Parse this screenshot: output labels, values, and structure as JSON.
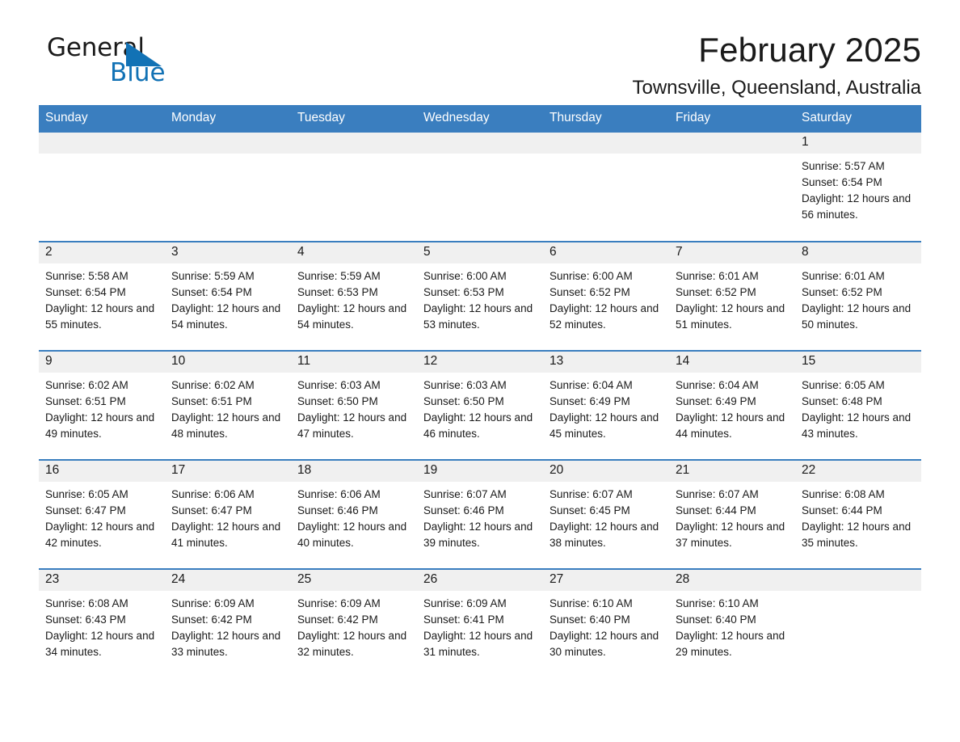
{
  "brand": {
    "name_dark": "General",
    "name_blue": "Blue",
    "accent_color": "#1272b5"
  },
  "header": {
    "title": "February 2025",
    "subtitle": "Townsville, Queensland, Australia"
  },
  "theme": {
    "header_blue": "#3a7ebf",
    "daynum_band": "#f0f0f0",
    "text": "#1a1a1a"
  },
  "calendar": {
    "weekday_headers": [
      "Sunday",
      "Monday",
      "Tuesday",
      "Wednesday",
      "Thursday",
      "Friday",
      "Saturday"
    ],
    "weeks": [
      [
        {
          "day": "",
          "sunrise": "",
          "sunset": "",
          "daylight": ""
        },
        {
          "day": "",
          "sunrise": "",
          "sunset": "",
          "daylight": ""
        },
        {
          "day": "",
          "sunrise": "",
          "sunset": "",
          "daylight": ""
        },
        {
          "day": "",
          "sunrise": "",
          "sunset": "",
          "daylight": ""
        },
        {
          "day": "",
          "sunrise": "",
          "sunset": "",
          "daylight": ""
        },
        {
          "day": "",
          "sunrise": "",
          "sunset": "",
          "daylight": ""
        },
        {
          "day": "1",
          "sunrise": "Sunrise: 5:57 AM",
          "sunset": "Sunset: 6:54 PM",
          "daylight": "Daylight: 12 hours and 56 minutes."
        }
      ],
      [
        {
          "day": "2",
          "sunrise": "Sunrise: 5:58 AM",
          "sunset": "Sunset: 6:54 PM",
          "daylight": "Daylight: 12 hours and 55 minutes."
        },
        {
          "day": "3",
          "sunrise": "Sunrise: 5:59 AM",
          "sunset": "Sunset: 6:54 PM",
          "daylight": "Daylight: 12 hours and 54 minutes."
        },
        {
          "day": "4",
          "sunrise": "Sunrise: 5:59 AM",
          "sunset": "Sunset: 6:53 PM",
          "daylight": "Daylight: 12 hours and 54 minutes."
        },
        {
          "day": "5",
          "sunrise": "Sunrise: 6:00 AM",
          "sunset": "Sunset: 6:53 PM",
          "daylight": "Daylight: 12 hours and 53 minutes."
        },
        {
          "day": "6",
          "sunrise": "Sunrise: 6:00 AM",
          "sunset": "Sunset: 6:52 PM",
          "daylight": "Daylight: 12 hours and 52 minutes."
        },
        {
          "day": "7",
          "sunrise": "Sunrise: 6:01 AM",
          "sunset": "Sunset: 6:52 PM",
          "daylight": "Daylight: 12 hours and 51 minutes."
        },
        {
          "day": "8",
          "sunrise": "Sunrise: 6:01 AM",
          "sunset": "Sunset: 6:52 PM",
          "daylight": "Daylight: 12 hours and 50 minutes."
        }
      ],
      [
        {
          "day": "9",
          "sunrise": "Sunrise: 6:02 AM",
          "sunset": "Sunset: 6:51 PM",
          "daylight": "Daylight: 12 hours and 49 minutes."
        },
        {
          "day": "10",
          "sunrise": "Sunrise: 6:02 AM",
          "sunset": "Sunset: 6:51 PM",
          "daylight": "Daylight: 12 hours and 48 minutes."
        },
        {
          "day": "11",
          "sunrise": "Sunrise: 6:03 AM",
          "sunset": "Sunset: 6:50 PM",
          "daylight": "Daylight: 12 hours and 47 minutes."
        },
        {
          "day": "12",
          "sunrise": "Sunrise: 6:03 AM",
          "sunset": "Sunset: 6:50 PM",
          "daylight": "Daylight: 12 hours and 46 minutes."
        },
        {
          "day": "13",
          "sunrise": "Sunrise: 6:04 AM",
          "sunset": "Sunset: 6:49 PM",
          "daylight": "Daylight: 12 hours and 45 minutes."
        },
        {
          "day": "14",
          "sunrise": "Sunrise: 6:04 AM",
          "sunset": "Sunset: 6:49 PM",
          "daylight": "Daylight: 12 hours and 44 minutes."
        },
        {
          "day": "15",
          "sunrise": "Sunrise: 6:05 AM",
          "sunset": "Sunset: 6:48 PM",
          "daylight": "Daylight: 12 hours and 43 minutes."
        }
      ],
      [
        {
          "day": "16",
          "sunrise": "Sunrise: 6:05 AM",
          "sunset": "Sunset: 6:47 PM",
          "daylight": "Daylight: 12 hours and 42 minutes."
        },
        {
          "day": "17",
          "sunrise": "Sunrise: 6:06 AM",
          "sunset": "Sunset: 6:47 PM",
          "daylight": "Daylight: 12 hours and 41 minutes."
        },
        {
          "day": "18",
          "sunrise": "Sunrise: 6:06 AM",
          "sunset": "Sunset: 6:46 PM",
          "daylight": "Daylight: 12 hours and 40 minutes."
        },
        {
          "day": "19",
          "sunrise": "Sunrise: 6:07 AM",
          "sunset": "Sunset: 6:46 PM",
          "daylight": "Daylight: 12 hours and 39 minutes."
        },
        {
          "day": "20",
          "sunrise": "Sunrise: 6:07 AM",
          "sunset": "Sunset: 6:45 PM",
          "daylight": "Daylight: 12 hours and 38 minutes."
        },
        {
          "day": "21",
          "sunrise": "Sunrise: 6:07 AM",
          "sunset": "Sunset: 6:44 PM",
          "daylight": "Daylight: 12 hours and 37 minutes."
        },
        {
          "day": "22",
          "sunrise": "Sunrise: 6:08 AM",
          "sunset": "Sunset: 6:44 PM",
          "daylight": "Daylight: 12 hours and 35 minutes."
        }
      ],
      [
        {
          "day": "23",
          "sunrise": "Sunrise: 6:08 AM",
          "sunset": "Sunset: 6:43 PM",
          "daylight": "Daylight: 12 hours and 34 minutes."
        },
        {
          "day": "24",
          "sunrise": "Sunrise: 6:09 AM",
          "sunset": "Sunset: 6:42 PM",
          "daylight": "Daylight: 12 hours and 33 minutes."
        },
        {
          "day": "25",
          "sunrise": "Sunrise: 6:09 AM",
          "sunset": "Sunset: 6:42 PM",
          "daylight": "Daylight: 12 hours and 32 minutes."
        },
        {
          "day": "26",
          "sunrise": "Sunrise: 6:09 AM",
          "sunset": "Sunset: 6:41 PM",
          "daylight": "Daylight: 12 hours and 31 minutes."
        },
        {
          "day": "27",
          "sunrise": "Sunrise: 6:10 AM",
          "sunset": "Sunset: 6:40 PM",
          "daylight": "Daylight: 12 hours and 30 minutes."
        },
        {
          "day": "28",
          "sunrise": "Sunrise: 6:10 AM",
          "sunset": "Sunset: 6:40 PM",
          "daylight": "Daylight: 12 hours and 29 minutes."
        },
        {
          "day": "",
          "sunrise": "",
          "sunset": "",
          "daylight": ""
        }
      ]
    ]
  }
}
